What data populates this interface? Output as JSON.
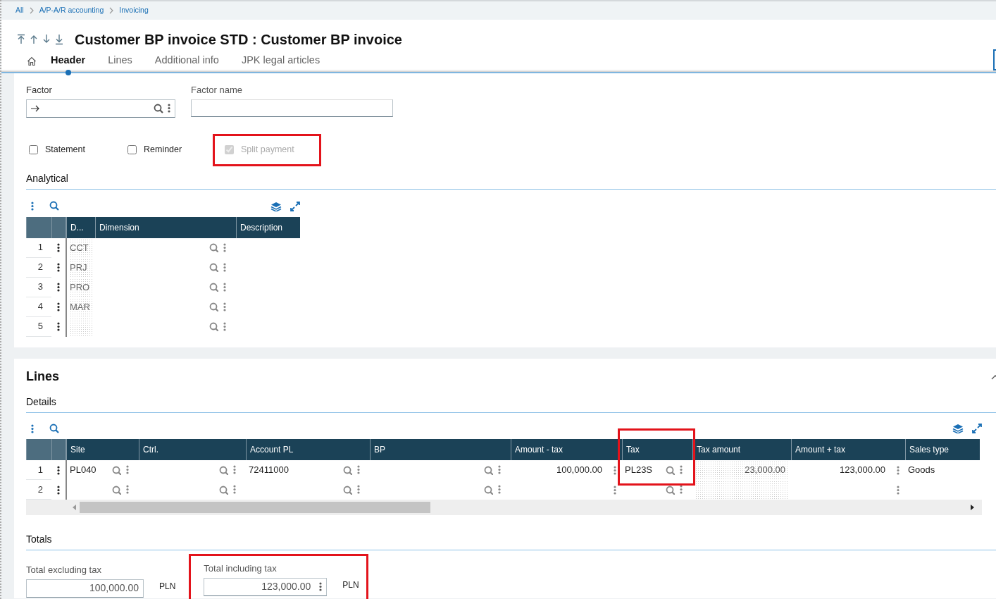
{
  "breadcrumb": [
    "All",
    "A/P-A/R accounting",
    "Invoicing"
  ],
  "title": "Customer BP invoice STD : Customer BP invoice",
  "tabs": [
    {
      "label": "Header",
      "selected": true
    },
    {
      "label": "Lines",
      "selected": false
    },
    {
      "label": "Additional info",
      "selected": false
    },
    {
      "label": "JPK legal articles",
      "selected": false
    }
  ],
  "factor": {
    "label": "Factor"
  },
  "factor_name": {
    "label": "Factor name"
  },
  "checkboxes": [
    {
      "label": "Statement",
      "checked": false,
      "disabled": false,
      "highlighted": false
    },
    {
      "label": "Reminder",
      "checked": false,
      "disabled": false,
      "highlighted": false
    },
    {
      "label": "Split payment",
      "checked": true,
      "disabled": true,
      "highlighted": true
    }
  ],
  "analytical": {
    "title": "Analytical",
    "columns": [
      {
        "label": "D...",
        "kind": "code",
        "highlighted": false
      },
      {
        "label": "Dimension",
        "kind": "lookup",
        "highlighted": false
      },
      {
        "label": "Description",
        "kind": "text",
        "highlighted": false
      }
    ],
    "rows": [
      {
        "number": "1",
        "cells": [
          {
            "value": "CCT"
          },
          {},
          {}
        ]
      },
      {
        "number": "2",
        "cells": [
          {
            "value": "PRJ"
          },
          {},
          {}
        ]
      },
      {
        "number": "3",
        "cells": [
          {
            "value": "PRO"
          },
          {},
          {}
        ]
      },
      {
        "number": "4",
        "cells": [
          {
            "value": "MAR"
          },
          {},
          {}
        ]
      },
      {
        "number": "5",
        "cells": [
          {},
          {},
          {}
        ]
      }
    ]
  },
  "lines": {
    "title": "Lines",
    "details_title": "Details",
    "columns": [
      {
        "label": "Site",
        "kind": "lookup",
        "highlighted": false
      },
      {
        "label": "Ctrl.",
        "kind": "lookup",
        "highlighted": false
      },
      {
        "label": "Account PL",
        "kind": "lookup",
        "highlighted": false
      },
      {
        "label": "BP",
        "kind": "lookup",
        "highlighted": false
      },
      {
        "label": "Amount - tax",
        "kind": "numeric",
        "highlighted": false
      },
      {
        "label": "Tax",
        "kind": "lookup",
        "highlighted": true
      },
      {
        "label": "Tax amount",
        "kind": "computed",
        "highlighted": false
      },
      {
        "label": "Amount + tax",
        "kind": "numeric",
        "highlighted": false
      },
      {
        "label": "Sales type",
        "kind": "text",
        "highlighted": false
      }
    ],
    "rows": [
      {
        "number": "1",
        "cells": [
          {
            "value": "PL040"
          },
          {},
          {
            "value": "72411000"
          },
          {},
          {
            "value": "100,000.00"
          },
          {
            "value": "PL23S"
          },
          {
            "value": "23,000.00"
          },
          {
            "value": "123,000.00"
          },
          {
            "value": "Goods"
          }
        ]
      },
      {
        "number": "2",
        "cells": [
          {},
          {},
          {},
          {},
          {},
          {},
          {},
          {},
          {}
        ]
      }
    ]
  },
  "totals": {
    "title": "Totals",
    "fields": [
      {
        "label": "Total excluding tax",
        "value": "100,000.00",
        "currency": "PLN",
        "has_menu": false,
        "highlighted": false
      },
      {
        "label": "Total including tax",
        "value": "123,000.00",
        "currency": "PLN",
        "has_menu": true,
        "highlighted": true
      }
    ]
  }
}
